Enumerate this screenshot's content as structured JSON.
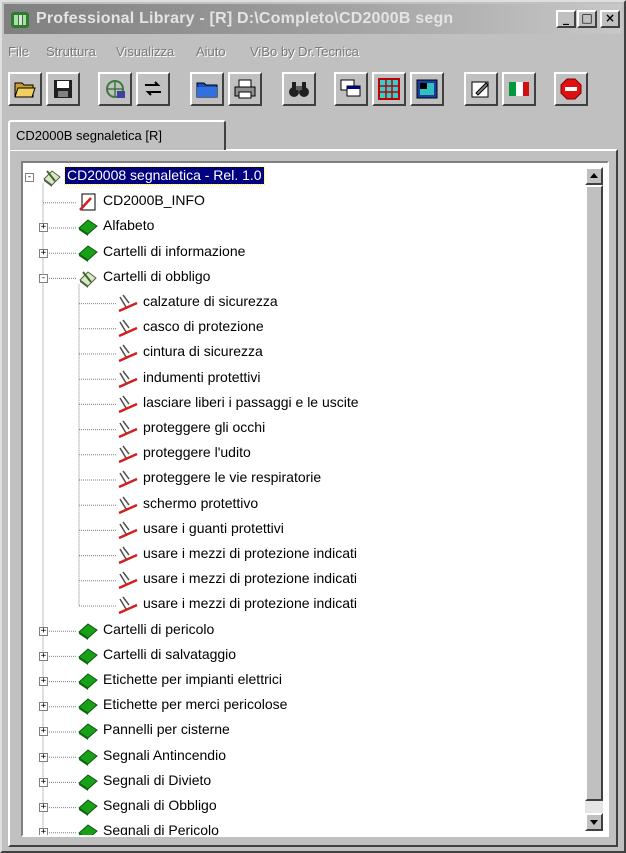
{
  "window": {
    "title": "Professional Library - [R] D:\\Completo\\CD2000B segn",
    "controls": [
      "_",
      "□",
      "×"
    ]
  },
  "menu": [
    {
      "label": "File"
    },
    {
      "label": "Struttura"
    },
    {
      "label": "Visualizza"
    },
    {
      "label": "Aiuto"
    },
    {
      "label": "ViBo by Dr.Tecnica"
    }
  ],
  "toolbar": {
    "buttons": [
      {
        "name": "open-folder-icon"
      },
      {
        "name": "save-icon"
      },
      {
        "name": "network-icon"
      },
      {
        "name": "transfer-icon"
      },
      {
        "name": "folder-icon"
      },
      {
        "name": "print-icon"
      },
      {
        "name": "binoculars-icon"
      },
      {
        "name": "windows-icon"
      },
      {
        "name": "grid-icon"
      },
      {
        "name": "image-icon"
      },
      {
        "name": "edit-icon"
      },
      {
        "name": "italian-flag-icon"
      },
      {
        "name": "stop-icon"
      }
    ]
  },
  "tab": {
    "label": "CD2000B segnaletica [R]"
  },
  "tree": {
    "root": "CD20008 segnaletica - Rel. 1.0",
    "info": "CD2000B_INFO",
    "categories_before": [
      "Alfabeto",
      "Cartelli di informazione"
    ],
    "expanded": "Cartelli di obbligo",
    "items": [
      "calzature di sicurezza",
      "casco di protezione",
      "cintura di sicurezza",
      "indumenti protettivi",
      "lasciare liberi i passaggi e le uscite",
      "proteggere gli occhi",
      "proteggere l'udito",
      "proteggere le vie respiratorie",
      "schermo protettivo",
      "usare i guanti protettivi",
      "usare i mezzi di protezione indicati",
      "usare i mezzi di protezione indicati",
      "usare i mezzi di protezione indicati"
    ],
    "categories_after": [
      "Cartelli di pericolo",
      "Cartelli di salvataggio",
      "Etichette per impianti elettrici",
      "Etichette per merci pericolose",
      "Pannelli per cisterne",
      "Segnali Antincendio",
      "Segnali di Divieto",
      "Segnali di Obbligo",
      "Segnali di Pericolo"
    ]
  }
}
